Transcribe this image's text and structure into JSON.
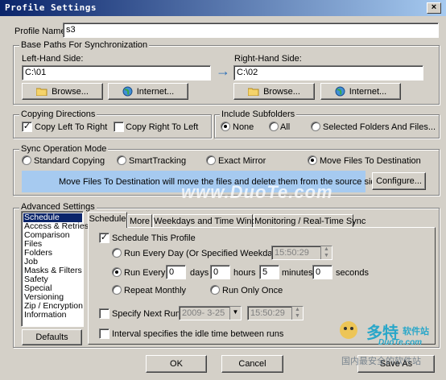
{
  "window": {
    "title": "Profile Settings",
    "close_glyph": "×"
  },
  "profile": {
    "label": "Profile Name:",
    "value": "s3"
  },
  "base_paths": {
    "legend": "Base Paths For Synchronization",
    "left_label": "Left-Hand Side:",
    "left_value": "C:\\01",
    "right_label": "Right-Hand Side:",
    "right_value": "C:\\02",
    "arrow": "→",
    "browse_label": "Browse...",
    "internet_label": "Internet..."
  },
  "copy_dir": {
    "legend": "Copying Directions",
    "left_to_right": "Copy Left To Right",
    "right_to_left": "Copy Right To Left",
    "check_mark": "✓"
  },
  "subfolders": {
    "legend": "Include Subfolders",
    "none": "None",
    "all": "All",
    "selected": "Selected Folders And Files..."
  },
  "sync_mode": {
    "legend": "Sync Operation Mode",
    "standard": "Standard Copying",
    "smart": "SmartTracking",
    "exact": "Exact Mirror",
    "move": "Move Files To Destination",
    "description": "Move Files To Destination will move the files and delete them from the source side.",
    "configure_label": "Configure..."
  },
  "advanced": {
    "legend": "Advanced Settings",
    "items": [
      "Schedule",
      "Access & Retries",
      "Comparison",
      "Files",
      "Folders",
      "Job",
      "Masks & Filters",
      "Safety",
      "Special",
      "Versioning",
      "Zip / Encryption",
      "Information"
    ],
    "defaults_label": "Defaults"
  },
  "tabs": [
    "Schedule",
    "More",
    "Weekdays and Time Window",
    "Monitoring / Real-Time Sync"
  ],
  "schedule": {
    "schedule_profile": "Schedule This Profile",
    "every_day": "Run Every Day (Or Specified Weekdays) At",
    "every_day_time": "15:50:29",
    "run_every": "Run Every",
    "days_value": "0",
    "days_label": "days",
    "hours_value": "0",
    "hours_label": "hours",
    "minutes_value": "5",
    "minutes_label": "minutes",
    "seconds_value": "0",
    "seconds_label": "seconds",
    "monthly": "Repeat Monthly",
    "once": "Run Only Once",
    "next_run": "Specify Next Run:",
    "next_date": "2009- 3-25",
    "next_time": "15:50:29",
    "idle": "Interval specifies the idle time between runs"
  },
  "footer": {
    "ok_label": "OK",
    "cancel_label": "Cancel",
    "save_as_label": "Save As"
  },
  "watermarks": {
    "center": "www.DuoTe.com",
    "brand_cn": "多特",
    "brand_sub": "软件站",
    "brand_url": "DuoTe.com",
    "bottom_cn": "国内最安全的软件站"
  },
  "colors": {
    "title_start": "#0a246a",
    "title_end": "#a6caf0",
    "info_panel": "#a6caf0",
    "selection": "#0a246a",
    "arrow": "#2d6fb7"
  }
}
